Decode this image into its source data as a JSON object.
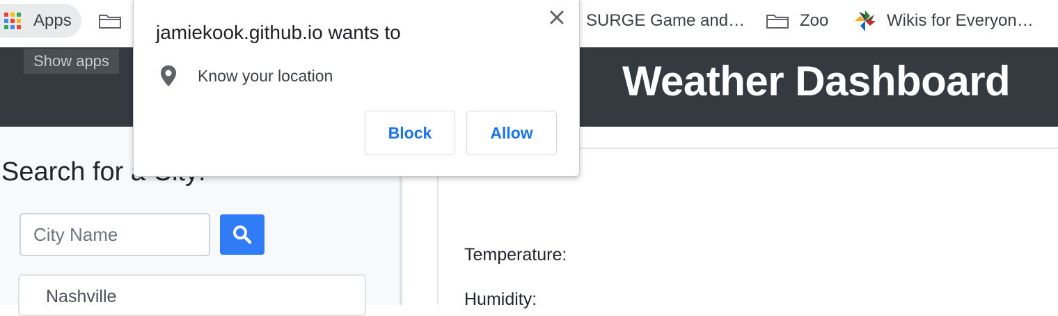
{
  "bookmarks": {
    "apps_label": "Apps",
    "items": [
      {
        "label": "SURGE Game and…"
      },
      {
        "label": "Zoo"
      },
      {
        "label": "Wikis for Everyon…"
      }
    ]
  },
  "tooltip": {
    "text": "Show apps"
  },
  "header": {
    "title": "Weather Dashboard"
  },
  "sidebar": {
    "heading": "Search for a City:",
    "search_placeholder": "City Name",
    "history": [
      {
        "label": "Nashville"
      }
    ]
  },
  "main": {
    "temperature_label": "Temperature:",
    "humidity_label": "Humidity:"
  },
  "dialog": {
    "title": "jamiekook.github.io wants to",
    "permission_text": "Know your location",
    "block_label": "Block",
    "allow_label": "Allow",
    "icons": {
      "close": "close-icon",
      "permission": "location-pin-icon"
    }
  },
  "colors": {
    "header_bg": "#343a40",
    "primary_button": "#2f7cf6",
    "dialog_button_text": "#1a73e8"
  }
}
